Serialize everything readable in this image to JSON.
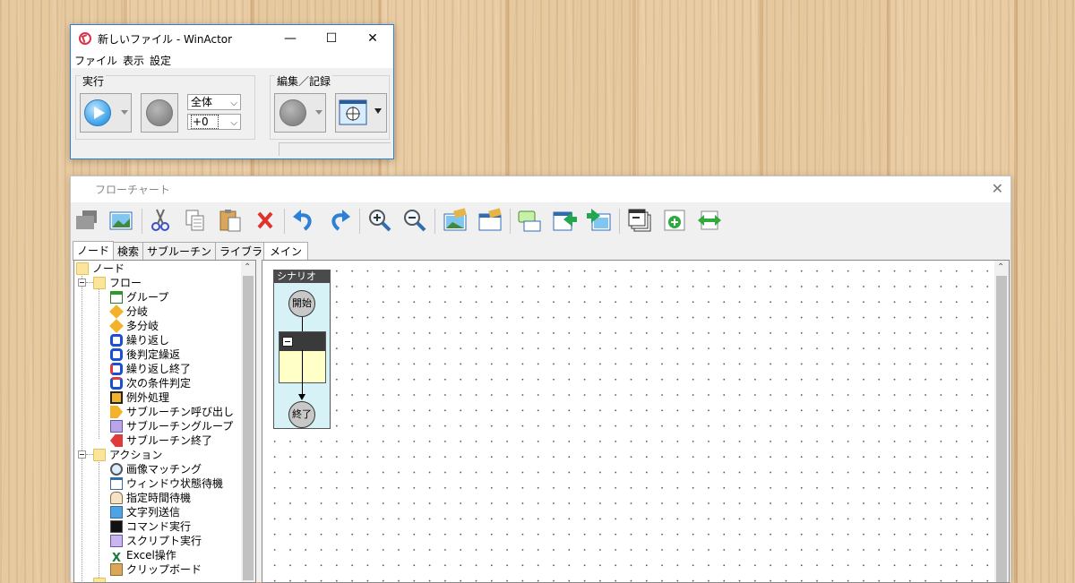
{
  "winactor": {
    "title": "新しいファイル - WinActor",
    "controls": {
      "minimize": "—",
      "maximize": "☐",
      "close": "✕"
    },
    "menu": [
      "ファイル",
      "表示",
      "設定"
    ],
    "run_group": {
      "label": "実行",
      "scope_select": "全体",
      "offset_select": "+0"
    },
    "edit_group": {
      "label": "編集／記録"
    }
  },
  "flowchart": {
    "title": "フローチャート",
    "close": "✕",
    "left_tabs": [
      "ノード",
      "検索",
      "サブルーチン",
      "ライブラリ"
    ],
    "main_tab": "メイン",
    "tree": {
      "root": "ノード",
      "flow": {
        "label": "フロー",
        "items": [
          "グループ",
          "分岐",
          "多分岐",
          "繰り返し",
          "後判定繰返",
          "繰り返し終了",
          "次の条件判定",
          "例外処理",
          "サブルーチン呼び出し",
          "サブルーチングループ",
          "サブルーチン終了"
        ]
      },
      "action": {
        "label": "アクション",
        "items": [
          "画像マッチング",
          "ウィンドウ状態待機",
          "指定時間待機",
          "文字列送信",
          "コマンド実行",
          "スクリプト実行",
          "Excel操作",
          "クリップボード"
        ]
      }
    },
    "scenario": {
      "header": "シナリオ",
      "start": "開始",
      "end": "終了"
    }
  }
}
